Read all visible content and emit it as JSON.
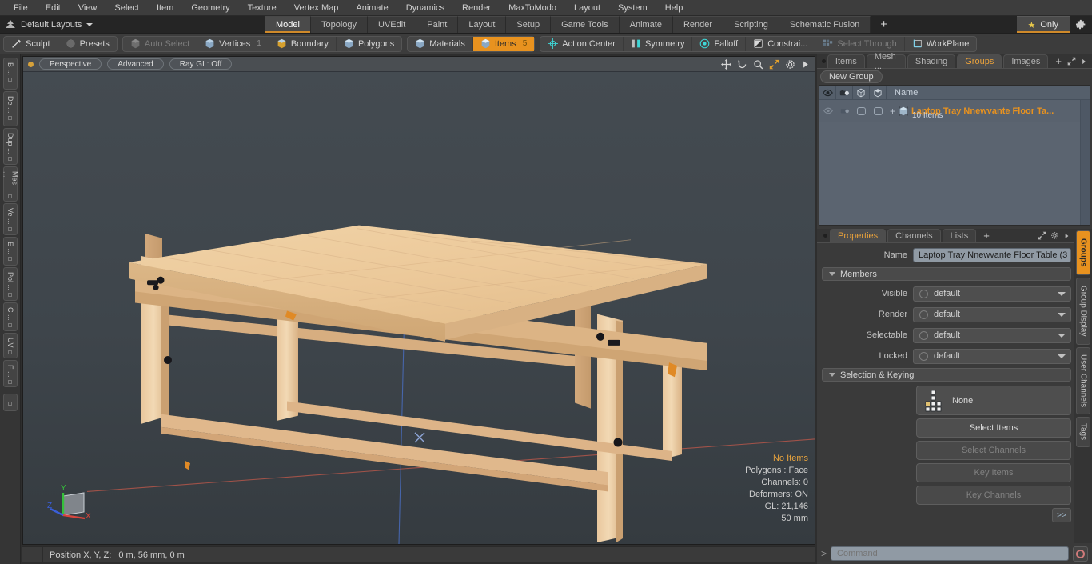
{
  "menubar": {
    "items": [
      "File",
      "Edit",
      "View",
      "Select",
      "Item",
      "Geometry",
      "Texture",
      "Vertex Map",
      "Animate",
      "Dynamics",
      "Render",
      "MaxToModo",
      "Layout",
      "System",
      "Help"
    ]
  },
  "layoutbar": {
    "preset_label": "Default Layouts",
    "tabs": [
      {
        "label": "Model",
        "active": true
      },
      {
        "label": "Topology",
        "active": false
      },
      {
        "label": "UVEdit",
        "active": false
      },
      {
        "label": "Paint",
        "active": false
      },
      {
        "label": "Layout",
        "active": false
      },
      {
        "label": "Setup",
        "active": false
      },
      {
        "label": "Game Tools",
        "active": false
      },
      {
        "label": "Animate",
        "active": false
      },
      {
        "label": "Render",
        "active": false
      },
      {
        "label": "Scripting",
        "active": false
      },
      {
        "label": "Schematic Fusion",
        "active": false
      }
    ],
    "add_label": "+",
    "only_label": "Only"
  },
  "modebar": {
    "left_group": [
      {
        "label": "Sculpt",
        "icon": "brush-icon",
        "state": "normal"
      },
      {
        "label": "Presets",
        "icon": "sphere-icon",
        "state": "normal"
      }
    ],
    "select_group": [
      {
        "label": "Auto Select",
        "icon": "cube-icon",
        "state": "disabled",
        "count": ""
      },
      {
        "label": "Vertices",
        "icon": "cube-icon",
        "state": "normal",
        "count": "1"
      },
      {
        "label": "Boundary",
        "icon": "cube-icon",
        "state": "normal",
        "count": ""
      },
      {
        "label": "Polygons",
        "icon": "cube-icon",
        "state": "normal",
        "count": ""
      }
    ],
    "mode_group": [
      {
        "label": "Materials",
        "icon": "cube-icon",
        "state": "normal",
        "count": ""
      },
      {
        "label": "Items",
        "icon": "cube-icon",
        "state": "selected",
        "count": "5"
      }
    ],
    "tool_group": [
      {
        "label": "Action Center",
        "icon": "action-center-icon",
        "state": "normal"
      },
      {
        "label": "Symmetry",
        "icon": "symmetry-icon",
        "state": "normal"
      },
      {
        "label": "Falloff",
        "icon": "falloff-icon",
        "state": "normal"
      },
      {
        "label": "Constrai...",
        "icon": "constraint-icon",
        "state": "normal"
      },
      {
        "label": "Select Through",
        "icon": "select-through-icon",
        "state": "disabled"
      },
      {
        "label": "WorkPlane",
        "icon": "workplane-icon",
        "state": "normal"
      }
    ]
  },
  "left_strip": {
    "tabs": [
      "B ...",
      "De ...",
      "Dup ...",
      "Mes ...",
      "Ve ...",
      "E ...",
      "Pol ...",
      "C ...",
      "UV",
      "F ..."
    ]
  },
  "viewport": {
    "header_buttons": [
      "Perspective",
      "Advanced",
      "Ray GL: Off"
    ],
    "header_icons": [
      "move-icon",
      "rotate-icon",
      "zoom-icon",
      "maximize-icon",
      "gear-icon",
      "play-icon"
    ],
    "stats": {
      "selection": "No Items",
      "polygons": "Polygons : Face",
      "channels": "Channels: 0",
      "deformers": "Deformers: ON",
      "gl": "GL: 21,146",
      "scale": "50 mm"
    },
    "axis_gizmo": {
      "x": "X",
      "y": "Y",
      "z": "Z"
    },
    "background_color": "#3c4348",
    "wood_color": "#e8c79a"
  },
  "statusbar": {
    "position_label": "Position X, Y, Z:",
    "position_value": "0 m, 56 mm, 0 m"
  },
  "right_panel": {
    "top_tabs": [
      {
        "label": "Items",
        "active": false
      },
      {
        "label": "Mesh ...",
        "active": false
      },
      {
        "label": "Shading",
        "active": false
      },
      {
        "label": "Groups",
        "active": true
      },
      {
        "label": "Images",
        "active": false
      }
    ],
    "top_tabs_plus": "+",
    "new_group_label": "New Group",
    "item_list": {
      "columns": [
        "eye-icon",
        "render-icon",
        "cube-icon",
        "cube-outline-icon"
      ],
      "name_header": "Name",
      "rows": [
        {
          "title": "Laptop Tray Nnewvante Floor Ta...",
          "subtitle": "10 Items",
          "expander": "+"
        }
      ]
    },
    "property_tabs": [
      {
        "label": "Properties",
        "active": true
      },
      {
        "label": "Channels",
        "active": false
      },
      {
        "label": "Lists",
        "active": false
      }
    ],
    "property_tabs_plus": "+",
    "properties": {
      "name_label": "Name",
      "name_value": "Laptop Tray Nnewvante Floor Table (3",
      "members_section": "Members",
      "member_rows": [
        {
          "label": "Visible",
          "value": "default"
        },
        {
          "label": "Render",
          "value": "default"
        },
        {
          "label": "Selectable",
          "value": "default"
        },
        {
          "label": "Locked",
          "value": "default"
        }
      ],
      "keying_section": "Selection & Keying",
      "keying_value": "None",
      "keying_buttons": [
        {
          "label": "Select Items",
          "disabled": false
        },
        {
          "label": "Select Channels",
          "disabled": true
        },
        {
          "label": "Key Items",
          "disabled": true
        },
        {
          "label": "Key Channels",
          "disabled": true
        }
      ],
      "forward_label": ">>"
    },
    "side_tabs": [
      {
        "label": "Groups",
        "active": true
      },
      {
        "label": "Group Display",
        "active": false
      },
      {
        "label": "User Channels",
        "active": false
      },
      {
        "label": "Tags",
        "active": false
      }
    ]
  },
  "command_bar": {
    "prompt": ">",
    "placeholder": "Command"
  }
}
